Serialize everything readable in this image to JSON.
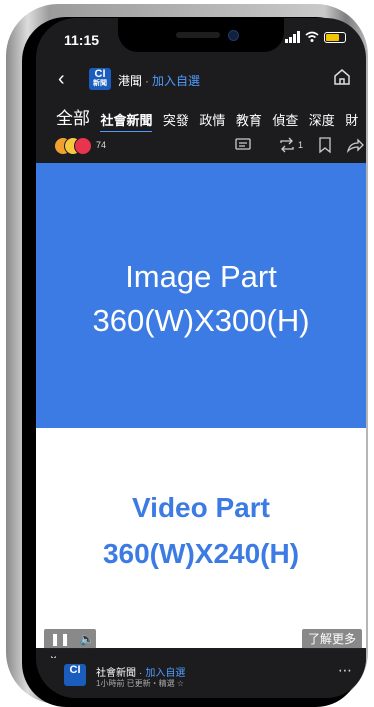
{
  "status": {
    "time": "11:15"
  },
  "nav": {
    "logo_top": "CI",
    "logo_bottom": "新聞",
    "source": "港聞",
    "follow": "加入自選"
  },
  "tabs": [
    {
      "label": "全部"
    },
    {
      "label": "社會新聞"
    },
    {
      "label": "突發"
    },
    {
      "label": "政情"
    },
    {
      "label": "教育"
    },
    {
      "label": "偵查"
    },
    {
      "label": "深度"
    },
    {
      "label": "財"
    }
  ],
  "reactions": {
    "count": "74",
    "share_count": "1"
  },
  "image_part": {
    "line1": "Image Part",
    "line2": "360(W)X300(H)"
  },
  "video_part": {
    "line1": "Video Part",
    "line2": "360(W)X240(H)"
  },
  "player": {
    "learn_more": "了解更多"
  },
  "next_post": {
    "logo_top": "CI",
    "logo_bottom": "新聞",
    "source": "社會新聞",
    "follow": "加入自選",
    "meta": "1小時前 已更新・精選 ☆"
  },
  "colors": {
    "accent": "#4f9bff",
    "image_bg": "#3c7be3",
    "video_text": "#3c7be3"
  }
}
